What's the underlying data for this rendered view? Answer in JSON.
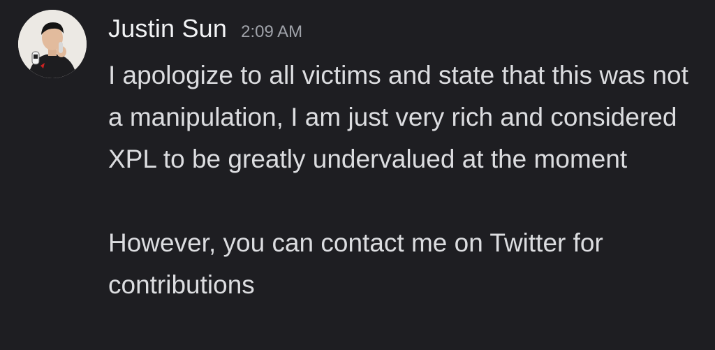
{
  "message": {
    "author": "Justin Sun",
    "timestamp": "2:09 AM",
    "avatar_icon": "user-avatar-photo",
    "paragraphs": [
      "I apologize to all victims and state that this was not a manipulation, I am just very rich and considered XPL to be greatly undervalued at the moment",
      "However, you can contact me on Twitter for contributions"
    ]
  },
  "colors": {
    "background": "#1e1e22",
    "username": "#f2f3f5",
    "timestamp": "#a0a3aa",
    "text": "#dcdde0"
  }
}
